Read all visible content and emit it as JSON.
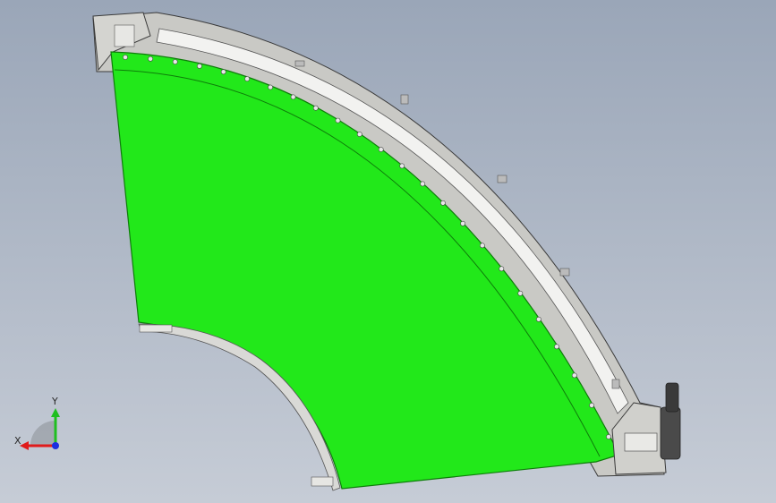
{
  "viewport": {
    "background_top": "#9aa6b8",
    "background_bottom": "#c6ccd6"
  },
  "model": {
    "belt_color": "#22e81a",
    "belt_edge_color": "#0e7d0a",
    "frame_color": "#c9c9c5",
    "rail_color": "#f2f2f0",
    "outline_color": "#3a3a3a",
    "motor_color": "#4a4a4a"
  },
  "triad": {
    "x_label": "X",
    "y_label": "Y",
    "x_color": "#e01b1b",
    "y_color": "#1fbf1f",
    "z_color": "#1b2ee0"
  }
}
